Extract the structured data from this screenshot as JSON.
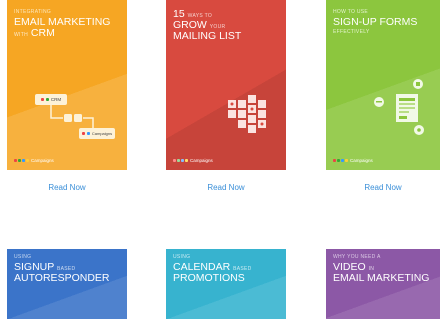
{
  "cards": [
    {
      "line1": "INTEGRATING",
      "line2": "EMAIL MARKETING",
      "line3_pre": "WITH",
      "line3": "CRM",
      "brand": "Campaigns",
      "chip1": "CRM",
      "chip2": "Campaigns",
      "read": "Read Now"
    },
    {
      "line1_num": "15",
      "line1": "WAYS TO",
      "line2": "GROW",
      "line2_post": "YOUR",
      "line3": "MAILING LIST",
      "brand": "Campaigns",
      "read": "Read Now"
    },
    {
      "line1": "HOW TO USE",
      "line2": "SIGN-UP FORMS",
      "line3": "EFFECTIVELY",
      "brand": "Campaigns",
      "read": "Read Now"
    },
    {
      "line1": "USING",
      "line2": "SIGNUP",
      "line2_post": "BASED",
      "line3": "AUTORESPONDER"
    },
    {
      "line1": "USING",
      "line2": "CALENDAR",
      "line2_post": "BASED",
      "line3": "PROMOTIONS"
    },
    {
      "line1": "WHY YOU NEED A",
      "line2": "VIDEO",
      "line2_post": "IN",
      "line3": "EMAIL MARKETING"
    }
  ],
  "colors": {
    "orange": "#f6a623",
    "red": "#d84a3f",
    "green": "#8cc63e",
    "blue": "#3b74c9",
    "teal": "#37b3cf",
    "purple": "#8c58a6",
    "link": "#3a8fd8"
  }
}
